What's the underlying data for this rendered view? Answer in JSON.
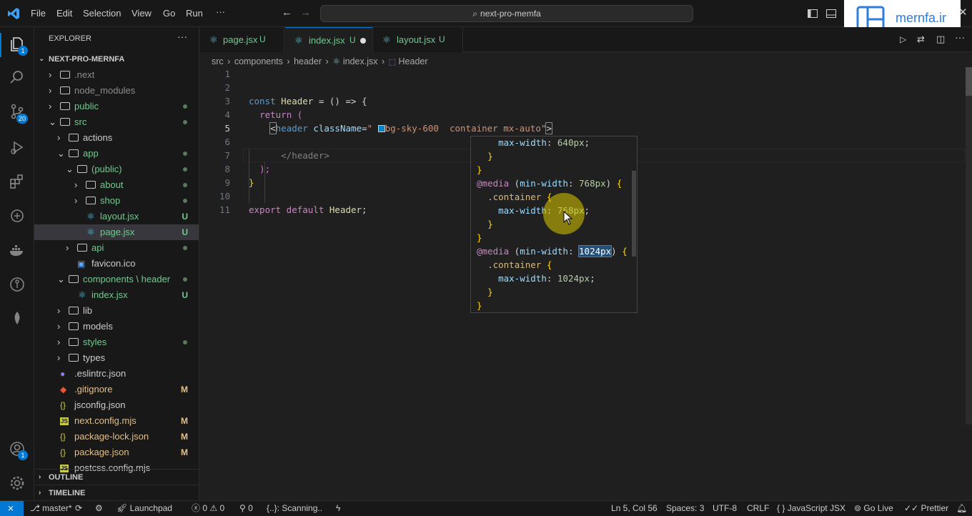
{
  "menu": [
    "File",
    "Edit",
    "Selection",
    "View",
    "Go",
    "Run",
    "···"
  ],
  "search": {
    "text": "next-pro-memfa"
  },
  "logo": {
    "text": "mernfa.ir"
  },
  "activity": {
    "explorer_badge": "1",
    "scm_badge": "20",
    "account_badge": "1"
  },
  "sidebar": {
    "title": "EXPLORER",
    "project": "NEXT-PRO-MERNFA",
    "items": [
      {
        "label": ".next",
        "kind": "folder",
        "color": "#8c8c8c"
      },
      {
        "label": "node_modules",
        "kind": "folder",
        "color": "#8c8c8c"
      },
      {
        "label": "public",
        "kind": "folder",
        "color": "#73c991"
      },
      {
        "label": "src",
        "kind": "folder",
        "color": "#73c991"
      },
      {
        "label": "actions",
        "kind": "folder",
        "color": "#cccccc"
      },
      {
        "label": "app",
        "kind": "folder",
        "color": "#73c991"
      },
      {
        "label": "(public)",
        "kind": "folder",
        "color": "#73c991"
      },
      {
        "label": "about",
        "kind": "folder",
        "color": "#73c991"
      },
      {
        "label": "shop",
        "kind": "folder",
        "color": "#73c991"
      },
      {
        "label": "layout.jsx",
        "kind": "react",
        "color": "#73c991",
        "mark": "U"
      },
      {
        "label": "page.jsx",
        "kind": "react",
        "color": "#73c991",
        "mark": "U"
      },
      {
        "label": "api",
        "kind": "folder",
        "color": "#73c991"
      },
      {
        "label": "favicon.ico",
        "kind": "ico",
        "color": "#cccccc"
      },
      {
        "label": "components \\ header",
        "kind": "folder",
        "color": "#73c991"
      },
      {
        "label": "index.jsx",
        "kind": "react",
        "color": "#73c991",
        "mark": "U"
      },
      {
        "label": "lib",
        "kind": "folder",
        "color": "#cccccc"
      },
      {
        "label": "models",
        "kind": "folder",
        "color": "#cccccc"
      },
      {
        "label": "styles",
        "kind": "folder",
        "color": "#73c991"
      },
      {
        "label": "types",
        "kind": "folder",
        "color": "#cccccc"
      },
      {
        "label": ".eslintrc.json",
        "kind": "eslint",
        "color": "#cccccc"
      },
      {
        "label": ".gitignore",
        "kind": "git",
        "color": "#e2c08d",
        "mark": "M"
      },
      {
        "label": "jsconfig.json",
        "kind": "json",
        "color": "#cccccc"
      },
      {
        "label": "next.config.mjs",
        "kind": "js",
        "color": "#e2c08d",
        "mark": "M"
      },
      {
        "label": "package-lock.json",
        "kind": "json",
        "color": "#e2c08d",
        "mark": "M"
      },
      {
        "label": "package.json",
        "kind": "json",
        "color": "#e2c08d",
        "mark": "M"
      },
      {
        "label": "postcss.config.mjs",
        "kind": "js",
        "color": "#cccccc"
      }
    ],
    "outline": "OUTLINE",
    "timeline": "TIMELINE"
  },
  "tabs": [
    {
      "label": "page.jsx",
      "suffix": "U"
    },
    {
      "label": "index.jsx",
      "suffix": "U"
    },
    {
      "label": "layout.jsx",
      "suffix": "U"
    }
  ],
  "breadcrumb": [
    "src",
    "components",
    "header",
    "index.jsx",
    "Header"
  ],
  "code": {
    "line_numbers": [
      "1",
      "2",
      "3",
      "4",
      "5",
      "6",
      "7",
      "8",
      "9",
      "10",
      "11"
    ],
    "l3": {
      "kw": "const ",
      "name": "Header",
      "rest": " = () => {"
    },
    "l4": {
      "kw": "return",
      "paren": " ("
    },
    "l5": {
      "open": "<",
      "tag": "header",
      "attr": " className",
      "eq": "=",
      "q": "\"",
      "classes1": "bg-sky-600",
      "classes2": "  container mx-auto",
      "q2": "\"",
      "close": ">"
    },
    "l7": {
      "text": "</header>"
    },
    "l8": {
      "text": ");"
    },
    "l9": {
      "text": "}"
    },
    "l11": {
      "kw": "export default ",
      "name": "Header",
      "end": ";"
    }
  },
  "hover": {
    "lines": [
      "    max-width: 640px;",
      "  }",
      "}",
      "@media (min-width: 768px) {",
      "  .container {",
      "    max-width: 768px;",
      "  }",
      "}",
      "@media (min-width: 1024px) {",
      "  .container {",
      "    max-width: 1024px;",
      "  }",
      "}"
    ]
  },
  "status": {
    "branch": "master*",
    "launchpad": "Launchpad",
    "errors": "0",
    "warnings": "0",
    "ports": "0",
    "scanning": "{..}: Scanning..",
    "position": "Ln 5, Col 56",
    "spaces": "Spaces: 3",
    "encoding": "UTF-8",
    "eol": "CRLF",
    "language": "JavaScript JSX",
    "golive": "Go Live",
    "prettier": "Prettier"
  }
}
